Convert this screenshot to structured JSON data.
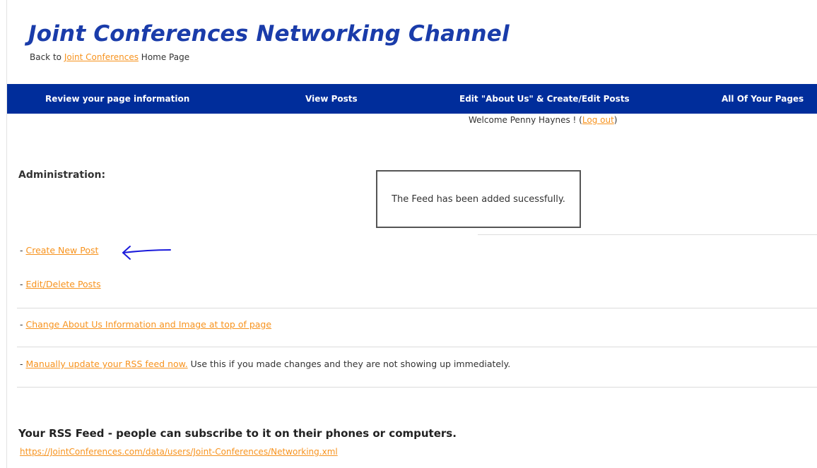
{
  "header": {
    "site_title": "Joint Conferences Networking Channel",
    "back_prefix": "Back to ",
    "back_link": "Joint Conferences",
    "back_suffix": " Home Page"
  },
  "nav": {
    "items": [
      {
        "label": "Review your page information"
      },
      {
        "label": "View Posts"
      },
      {
        "label": "Edit \"About Us\" & Create/Edit Posts"
      },
      {
        "label": "All Of Your Pages"
      }
    ],
    "background": "#002d9b"
  },
  "welcome": {
    "prefix": "Welcome Penny Haynes ! (",
    "logout": "Log out",
    "suffix": ")"
  },
  "admin": {
    "heading": "Administration:",
    "notice": "The Feed has been added sucessfully.",
    "links": [
      {
        "prefix": "- ",
        "label": "Create New Post",
        "suffix": ""
      },
      {
        "prefix": "- ",
        "label": "Edit/Delete Posts",
        "suffix": ""
      },
      {
        "prefix": "- ",
        "label": "Change About Us Information and Image at top of page",
        "suffix": ""
      },
      {
        "prefix": "- ",
        "label": "Manually update your RSS feed now.",
        "suffix": " Use this if you made changes and they are not showing up immediately."
      }
    ]
  },
  "rss": {
    "heading": "Your RSS Feed - people can subscribe to it on their phones or computers.",
    "url": "https://JointConferences.com/data/users/Joint-Conferences/Networking.xml"
  },
  "colors": {
    "title": "#1a3caa",
    "link": "#f7931e",
    "annotation_arrow": "#1a1adb"
  },
  "icons": {
    "annotation": "left-arrow-icon"
  }
}
